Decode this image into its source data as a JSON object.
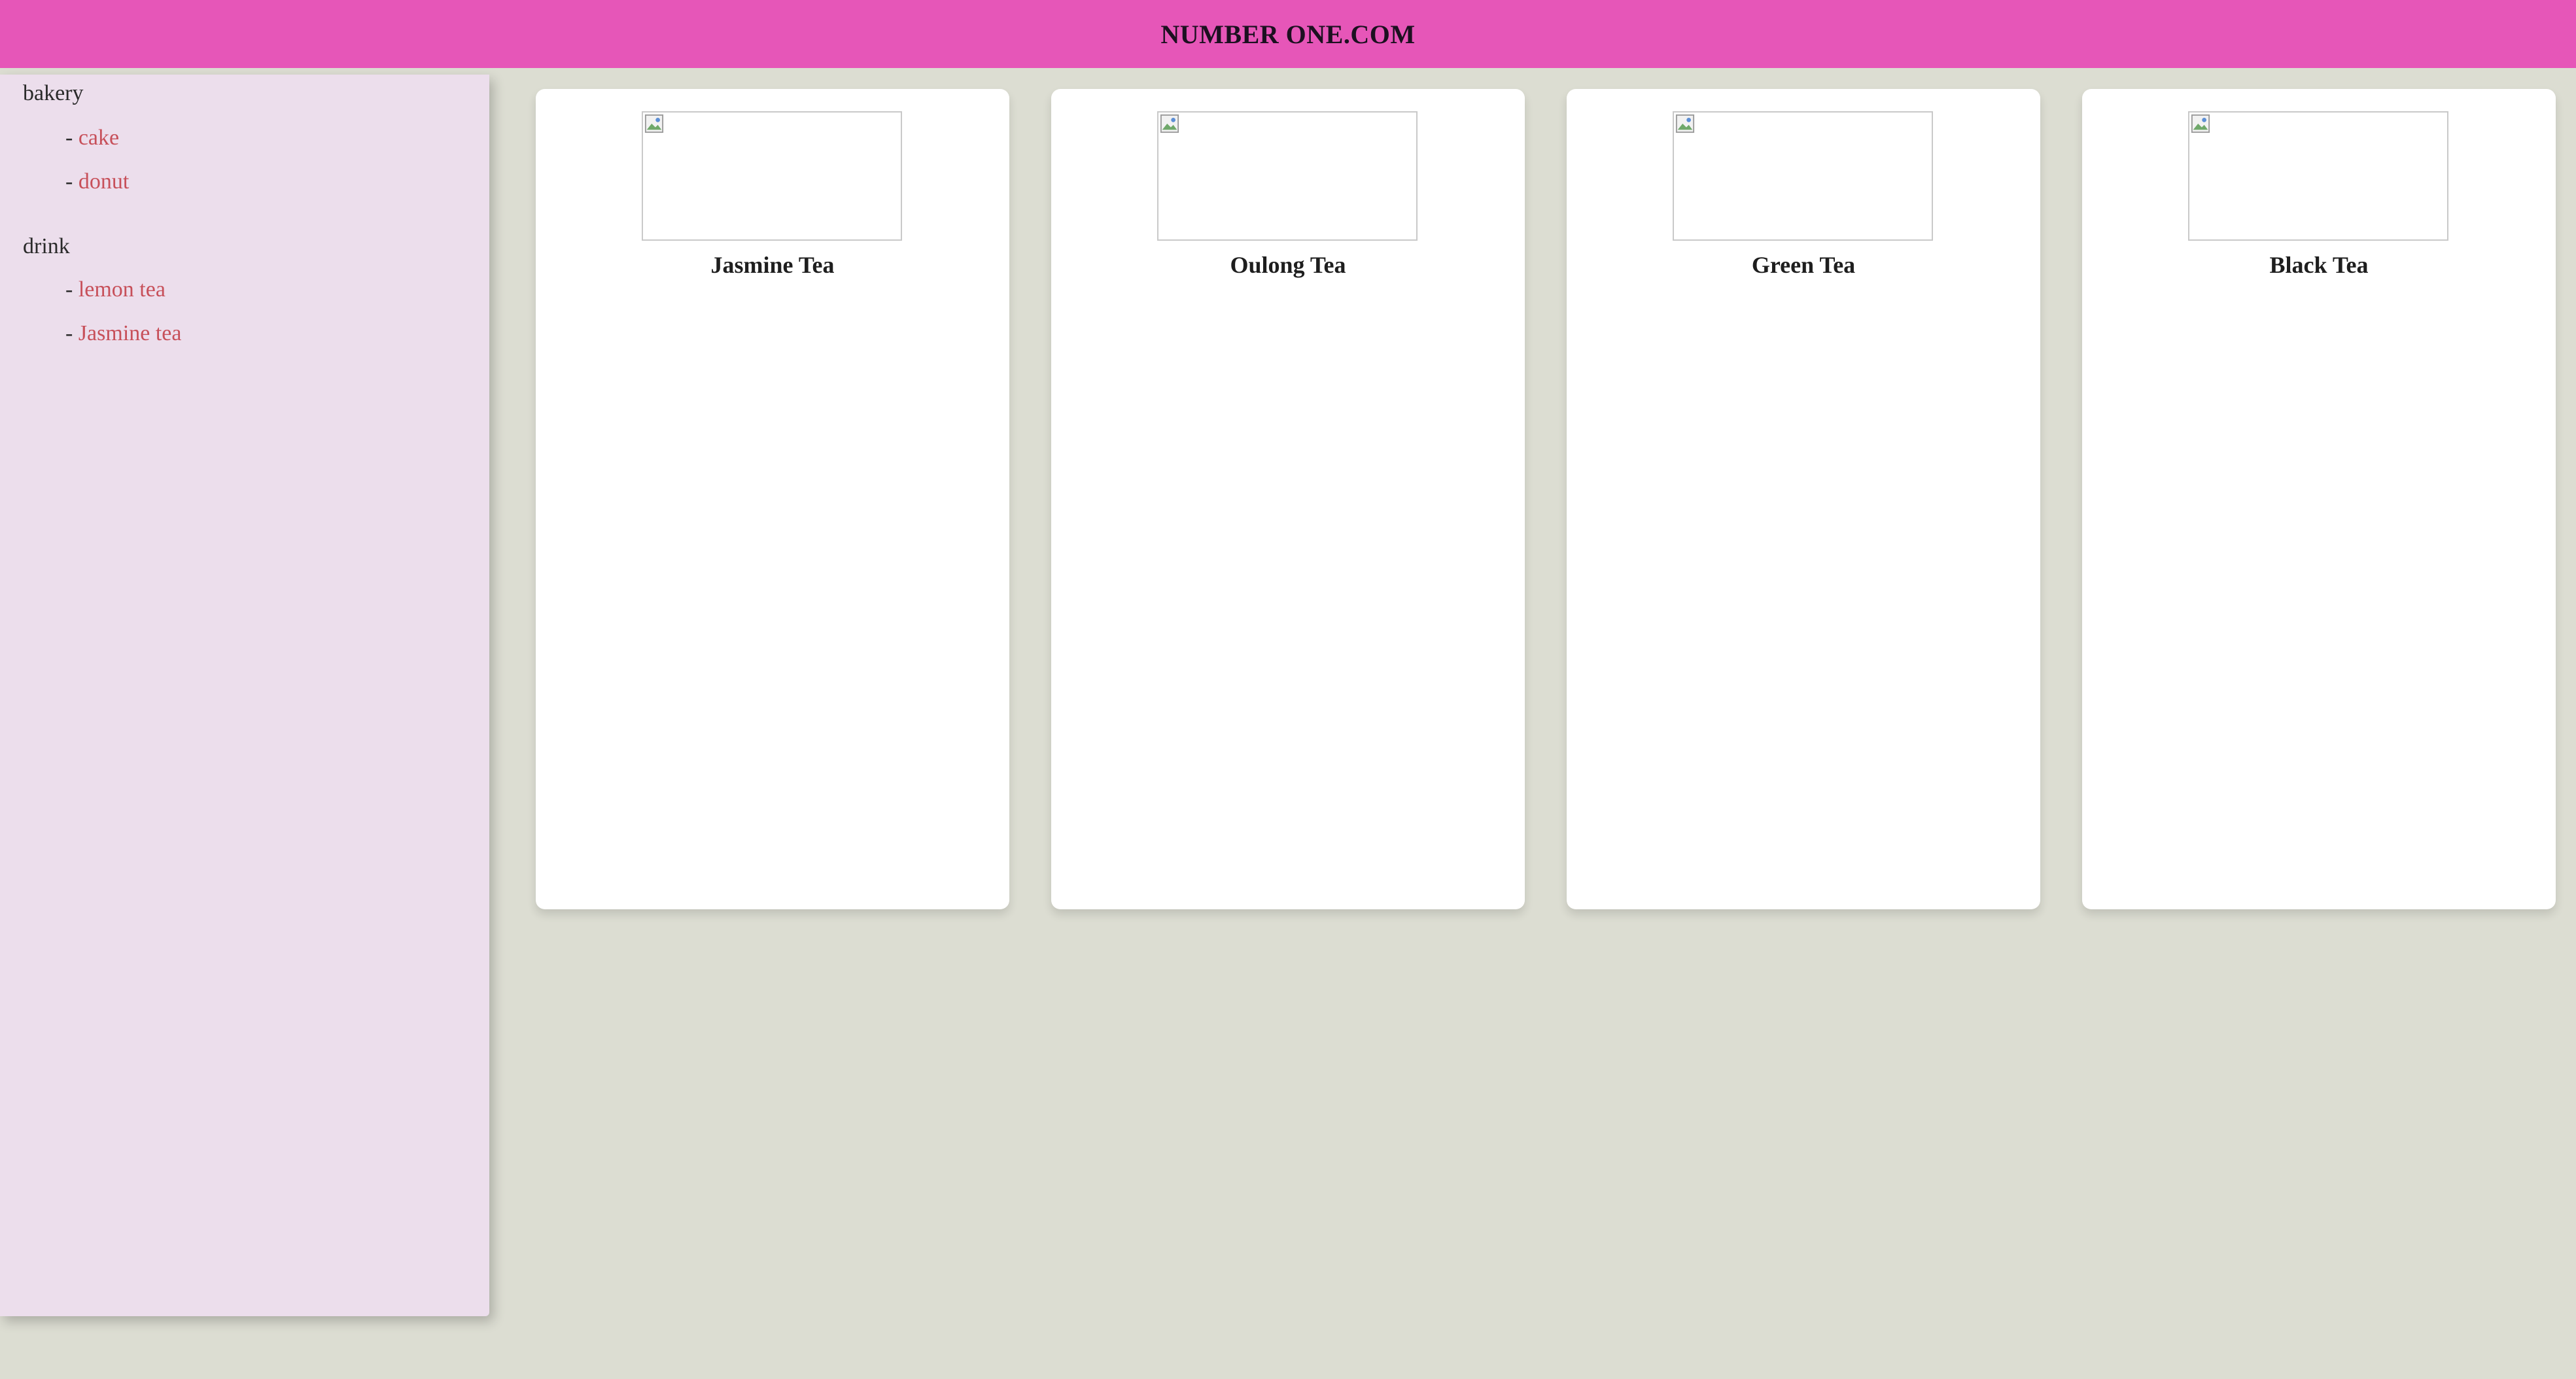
{
  "header": {
    "title": "NUMBER ONE.COM",
    "background_color": "#e656b8"
  },
  "sidebar": {
    "background_color": "#ecdeec",
    "categories": [
      {
        "title": "bakery",
        "items": [
          {
            "dash": "-",
            "label": "cake"
          },
          {
            "dash": "-",
            "label": "donut"
          }
        ]
      },
      {
        "title": "drink",
        "items": [
          {
            "dash": "-",
            "label": "lemon tea"
          },
          {
            "dash": "-",
            "label": "Jasmine tea"
          }
        ]
      }
    ],
    "link_color": "#c7505a"
  },
  "products": [
    {
      "name": "Jasmine Tea",
      "image_icon": "broken-image-icon"
    },
    {
      "name": "Oulong Tea",
      "image_icon": "broken-image-icon"
    },
    {
      "name": "Green Tea",
      "image_icon": "broken-image-icon"
    },
    {
      "name": "Black Tea",
      "image_icon": "broken-image-icon"
    }
  ],
  "page": {
    "background_color": "#dcddd2"
  }
}
